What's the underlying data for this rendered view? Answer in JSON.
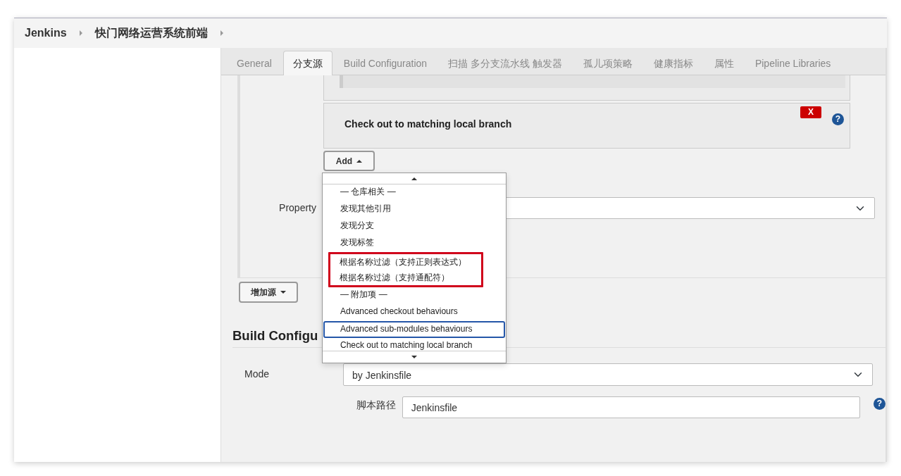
{
  "breadcrumbs": [
    {
      "label": "Jenkins"
    },
    {
      "label": "快门网络运营系统前端"
    }
  ],
  "tabs": [
    {
      "label": "General",
      "selected": false
    },
    {
      "label": "分支源",
      "selected": true
    },
    {
      "label": "Build Configuration",
      "selected": false
    },
    {
      "label": "扫描 多分支流水线 触发器",
      "selected": false
    },
    {
      "label": "孤儿项策略",
      "selected": false
    },
    {
      "label": "健康指标",
      "selected": false
    },
    {
      "label": "属性",
      "selected": false
    },
    {
      "label": "Pipeline Libraries",
      "selected": false
    }
  ],
  "traits": [
    {
      "kind": "partial"
    },
    {
      "kind": "full",
      "title": "Check out to matching local branch",
      "delete_label": "X",
      "help": "?"
    }
  ],
  "add_button": "Add",
  "property_label": "Property",
  "add_menu": {
    "items": [
      {
        "label": "— 仓库相关 —",
        "selected": false,
        "highlighted": false
      },
      {
        "label": "发现其他引用",
        "selected": false,
        "highlighted": false
      },
      {
        "label": "发现分支",
        "selected": false,
        "highlighted": false
      },
      {
        "label": "发现标签",
        "selected": false,
        "highlighted": false
      },
      {
        "label": "根据名称过滤（支持正则表达式）",
        "selected": false,
        "highlighted": true
      },
      {
        "label": "根据名称过滤（支持通配符）",
        "selected": false,
        "highlighted": true
      },
      {
        "label": "— 附加项 —",
        "selected": false,
        "highlighted": false
      },
      {
        "label": "Advanced checkout behaviours",
        "selected": false,
        "highlighted": false
      },
      {
        "label": "Advanced sub-modules behaviours",
        "selected": true,
        "highlighted": false
      },
      {
        "label": "Check out to matching local branch",
        "selected": false,
        "highlighted": false
      }
    ]
  },
  "add_source_button": "增加源",
  "build_section": {
    "heading": "Build Configu",
    "mode_label": "Mode",
    "mode_value": "by Jenkinsfile",
    "script_label": "脚本路径",
    "script_value": "Jenkinsfile",
    "help": "?"
  }
}
